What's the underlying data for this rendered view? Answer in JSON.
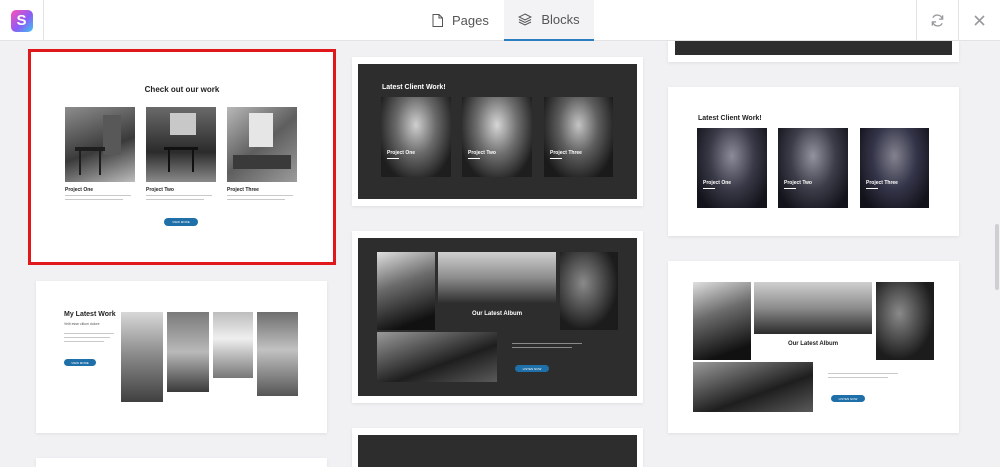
{
  "header": {
    "tabs": [
      {
        "label": "Pages",
        "icon": "page-icon"
      },
      {
        "label": "Blocks",
        "icon": "layers-icon",
        "active": true
      }
    ]
  },
  "colors": {
    "accent": "#2b7fbf",
    "selection": "#e0181b",
    "button": "#1f6fa8",
    "dark": "#2d2d2d"
  },
  "cards": {
    "work": {
      "title": "Check out our work",
      "projects": [
        {
          "name": "Project One",
          "text": "Tempor ut illo et ad velit excepteur non porta magna nulla"
        },
        {
          "name": "Project Two",
          "text": "Tempor ut illo et ad velit excepteur non porta magna nulla"
        },
        {
          "name": "Project Three",
          "text": "Tempor ut illo et ad velit excepteur non porta magna nulla"
        }
      ],
      "button": "VIEW MORE"
    },
    "client_dark": {
      "title": "Latest Client Work!",
      "projects": [
        "Project One",
        "Project Two",
        "Project Three"
      ]
    },
    "client_light": {
      "title": "Latest Client Work!",
      "projects": [
        "Project One",
        "Project Two",
        "Project Three"
      ]
    },
    "my_work": {
      "title": "My Latest Work",
      "subtitle": "Velit esse cillum dolore",
      "text": "Consectetur adipiscing elit sed do eiusmod tempor incididunt ut labore",
      "button": "VIEW MORE"
    },
    "album_dark": {
      "title": "Our Latest Album",
      "text": "Velit esse cillum dolore eu fugiat nulla pariatur excepteur sint",
      "button": "LISTEN NOW"
    },
    "album_light": {
      "title": "Our Latest Album",
      "text": "Velit esse cillum dolore eu fugiat nulla pariatur excepteur sint",
      "button": "LISTEN NOW"
    }
  }
}
